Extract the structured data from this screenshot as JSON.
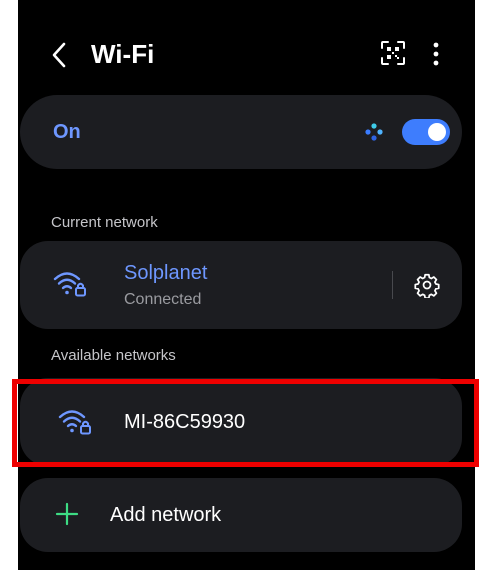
{
  "header": {
    "title": "Wi-Fi",
    "back_icon": "chevron-left-icon",
    "qr_icon": "qr-code-icon",
    "more_icon": "more-vertical-icon"
  },
  "wifi_toggle": {
    "label": "On",
    "state": true,
    "accent_color": "#6e97ff",
    "toggle_color": "#3e7dfd"
  },
  "current_network": {
    "section_label": "Current network",
    "name": "Solplanet",
    "status": "Connected",
    "icon": "wifi-lock-icon",
    "settings_icon": "gear-icon"
  },
  "available_networks": {
    "section_label": "Available networks",
    "items": [
      {
        "name": "MI-86C59930",
        "icon": "wifi-lock-icon"
      }
    ]
  },
  "add_network": {
    "label": "Add network",
    "icon": "plus-icon",
    "icon_color": "#3ddc84"
  },
  "highlight": {
    "color": "#ee0000",
    "target": "MI-86C59930"
  }
}
